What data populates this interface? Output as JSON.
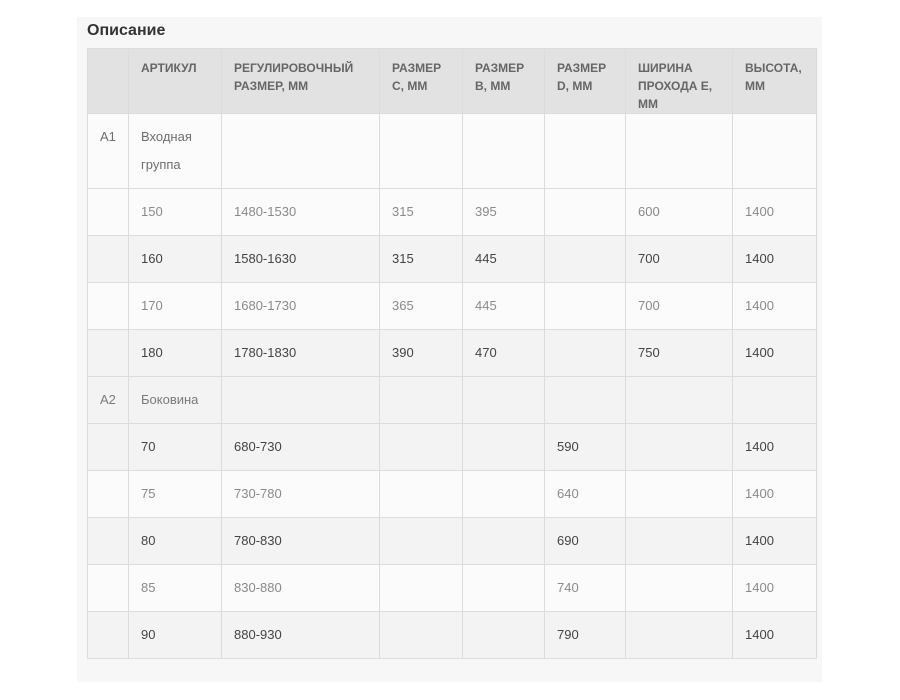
{
  "section_title": "Описание",
  "table": {
    "headers": [
      "",
      "АРТИКУЛ",
      "РЕГУЛИРОВОЧНЫЙ РАЗМЕР, ММ",
      "РАЗМЕР С, ММ",
      "РАЗМЕР В, ММ",
      "РАЗМЕР D, ММ",
      "ШИРИНА ПРОХОДА Е, ММ",
      "ВЫСОТА, ММ"
    ],
    "rows": [
      [
        "А1",
        "Входная группа",
        "",
        "",
        "",
        "",
        "",
        ""
      ],
      [
        "",
        "150",
        "1480-1530",
        "315",
        "395",
        "",
        "600",
        "1400"
      ],
      [
        "",
        "160",
        "1580-1630",
        "315",
        "445",
        "",
        "700",
        "1400"
      ],
      [
        "",
        "170",
        "1680-1730",
        "365",
        "445",
        "",
        "700",
        "1400"
      ],
      [
        "",
        "180",
        "1780-1830",
        "390",
        "470",
        "",
        "750",
        "1400"
      ],
      [
        "А2",
        "Боковина",
        "",
        "",
        "",
        "",
        "",
        ""
      ],
      [
        "",
        "70",
        "680-730",
        "",
        "",
        "590",
        "",
        "1400"
      ],
      [
        "",
        "75",
        "730-780",
        "",
        "",
        "640",
        "",
        "1400"
      ],
      [
        "",
        "80",
        "780-830",
        "",
        "",
        "690",
        "",
        "1400"
      ],
      [
        "",
        "85",
        "830-880",
        "",
        "",
        "740",
        "",
        "1400"
      ],
      [
        "",
        "90",
        "880-930",
        "",
        "",
        "790",
        "",
        "1400"
      ]
    ]
  }
}
